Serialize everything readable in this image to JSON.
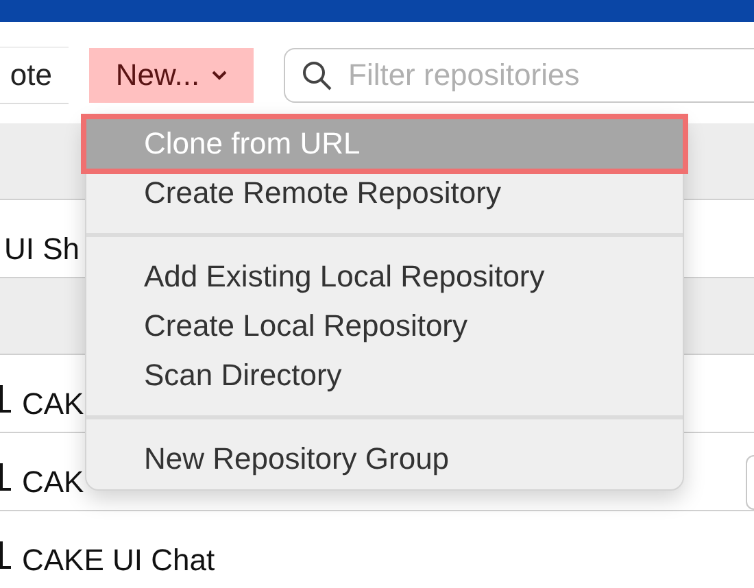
{
  "toolbar": {
    "buttons": [
      {
        "label": "ote",
        "kind": "plain",
        "highlighted": false
      },
      {
        "label": "New...",
        "kind": "dropdown",
        "highlighted": true
      }
    ],
    "search": {
      "placeholder": "Filter repositories"
    }
  },
  "list": [
    {
      "kind": "group"
    },
    {
      "kind": "repo",
      "name": "UI Sh",
      "child": false,
      "has_button": false
    },
    {
      "kind": "group"
    },
    {
      "kind": "repo",
      "name": "CAK",
      "child": true,
      "has_button": false
    },
    {
      "kind": "repo",
      "name": "CAK",
      "child": true,
      "has_button": true
    },
    {
      "kind": "repo",
      "name": "CAKE UI Chat",
      "child": true,
      "has_button": false
    }
  ],
  "menu": {
    "items": [
      {
        "kind": "item",
        "label": "Clone from URL",
        "selected": true,
        "highlighted": true
      },
      {
        "kind": "item",
        "label": "Create Remote Repository",
        "selected": false,
        "highlighted": false
      },
      {
        "kind": "separator"
      },
      {
        "kind": "item",
        "label": "Add Existing Local Repository",
        "selected": false,
        "highlighted": false
      },
      {
        "kind": "item",
        "label": "Create Local Repository",
        "selected": false,
        "highlighted": false
      },
      {
        "kind": "item",
        "label": "Scan Directory",
        "selected": false,
        "highlighted": false
      },
      {
        "kind": "separator"
      },
      {
        "kind": "item",
        "label": "New Repository Group",
        "selected": false,
        "highlighted": false
      }
    ]
  }
}
